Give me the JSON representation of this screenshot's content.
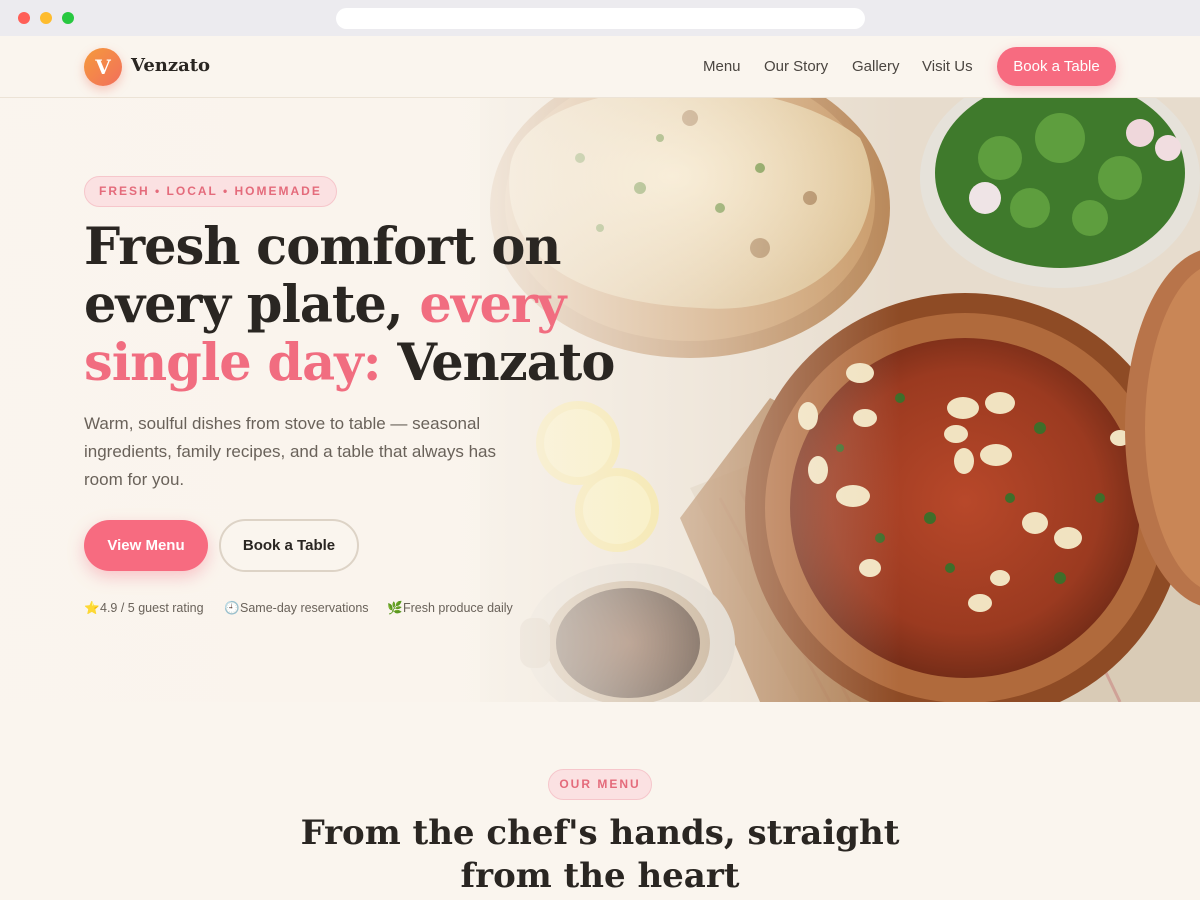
{
  "brand": {
    "logo_letter": "V",
    "name": "Venzato"
  },
  "nav": {
    "links": [
      "Menu",
      "Our Story",
      "Gallery",
      "Visit Us"
    ],
    "cta": "Book a Table"
  },
  "hero": {
    "eyebrow": "FRESH • LOCAL • HOMEMADE",
    "headline_part1": "Fresh comfort on every plate, ",
    "headline_accent": "every single day:",
    "headline_part2": " Venzato",
    "lede": "Warm, soulful dishes from stove to table — seasonal ingredients, family recipes, and a table that always has room for you.",
    "primary_cta": "View Menu",
    "secondary_cta": "Book a Table",
    "trust": [
      {
        "icon": "star-icon",
        "glyph": "⭐",
        "text": "4.9 / 5 guest rating"
      },
      {
        "icon": "clock-icon",
        "glyph": "🕘",
        "text": "Same-day reservations"
      },
      {
        "icon": "leaf-icon",
        "glyph": "🌿",
        "text": "Fresh produce daily"
      }
    ]
  },
  "menu_section": {
    "eyebrow": "OUR MENU",
    "title": "From the chef's hands, straight from the heart"
  },
  "colors": {
    "accent": "#f76b80",
    "accent_text": "#f16d80",
    "background": "#faf5ee",
    "text": "#2a2622"
  }
}
